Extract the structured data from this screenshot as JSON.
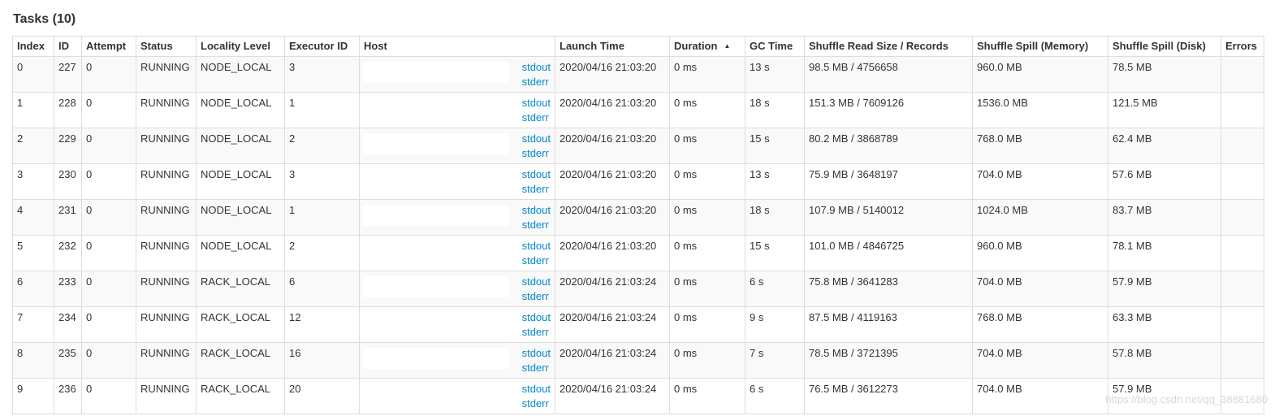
{
  "title": "Tasks (10)",
  "columns": [
    "Index",
    "ID",
    "Attempt",
    "Status",
    "Locality Level",
    "Executor ID",
    "Host",
    "Launch Time",
    "Duration",
    "GC Time",
    "Shuffle Read Size / Records",
    "Shuffle Spill (Memory)",
    "Shuffle Spill (Disk)",
    "Errors"
  ],
  "sort": {
    "column": "Duration",
    "direction": "ascending",
    "icon": "sort-up-icon"
  },
  "log_links": {
    "stdout": "stdout",
    "stderr": "stderr"
  },
  "rows": [
    {
      "index": "0",
      "id": "227",
      "attempt": "0",
      "status": "RUNNING",
      "locality": "NODE_LOCAL",
      "executor": "3",
      "launch": "2020/04/16 21:03:20",
      "duration": "0 ms",
      "gc": "13 s",
      "shuffle_read": "98.5 MB / 4756658",
      "spill_mem": "960.0 MB",
      "spill_disk": "78.5 MB",
      "errors": ""
    },
    {
      "index": "1",
      "id": "228",
      "attempt": "0",
      "status": "RUNNING",
      "locality": "NODE_LOCAL",
      "executor": "1",
      "launch": "2020/04/16 21:03:20",
      "duration": "0 ms",
      "gc": "18 s",
      "shuffle_read": "151.3 MB / 7609126",
      "spill_mem": "1536.0 MB",
      "spill_disk": "121.5 MB",
      "errors": ""
    },
    {
      "index": "2",
      "id": "229",
      "attempt": "0",
      "status": "RUNNING",
      "locality": "NODE_LOCAL",
      "executor": "2",
      "launch": "2020/04/16 21:03:20",
      "duration": "0 ms",
      "gc": "15 s",
      "shuffle_read": "80.2 MB / 3868789",
      "spill_mem": "768.0 MB",
      "spill_disk": "62.4 MB",
      "errors": ""
    },
    {
      "index": "3",
      "id": "230",
      "attempt": "0",
      "status": "RUNNING",
      "locality": "NODE_LOCAL",
      "executor": "3",
      "launch": "2020/04/16 21:03:20",
      "duration": "0 ms",
      "gc": "13 s",
      "shuffle_read": "75.9 MB / 3648197",
      "spill_mem": "704.0 MB",
      "spill_disk": "57.6 MB",
      "errors": ""
    },
    {
      "index": "4",
      "id": "231",
      "attempt": "0",
      "status": "RUNNING",
      "locality": "NODE_LOCAL",
      "executor": "1",
      "launch": "2020/04/16 21:03:20",
      "duration": "0 ms",
      "gc": "18 s",
      "shuffle_read": "107.9 MB / 5140012",
      "spill_mem": "1024.0 MB",
      "spill_disk": "83.7 MB",
      "errors": ""
    },
    {
      "index": "5",
      "id": "232",
      "attempt": "0",
      "status": "RUNNING",
      "locality": "NODE_LOCAL",
      "executor": "2",
      "launch": "2020/04/16 21:03:20",
      "duration": "0 ms",
      "gc": "15 s",
      "shuffle_read": "101.0 MB / 4846725",
      "spill_mem": "960.0 MB",
      "spill_disk": "78.1 MB",
      "errors": ""
    },
    {
      "index": "6",
      "id": "233",
      "attempt": "0",
      "status": "RUNNING",
      "locality": "RACK_LOCAL",
      "executor": "6",
      "launch": "2020/04/16 21:03:24",
      "duration": "0 ms",
      "gc": "6 s",
      "shuffle_read": "75.8 MB / 3641283",
      "spill_mem": "704.0 MB",
      "spill_disk": "57.9 MB",
      "errors": ""
    },
    {
      "index": "7",
      "id": "234",
      "attempt": "0",
      "status": "RUNNING",
      "locality": "RACK_LOCAL",
      "executor": "12",
      "launch": "2020/04/16 21:03:24",
      "duration": "0 ms",
      "gc": "9 s",
      "shuffle_read": "87.5 MB / 4119163",
      "spill_mem": "768.0 MB",
      "spill_disk": "63.3 MB",
      "errors": ""
    },
    {
      "index": "8",
      "id": "235",
      "attempt": "0",
      "status": "RUNNING",
      "locality": "RACK_LOCAL",
      "executor": "16",
      "launch": "2020/04/16 21:03:24",
      "duration": "0 ms",
      "gc": "7 s",
      "shuffle_read": "78.5 MB / 3721395",
      "spill_mem": "704.0 MB",
      "spill_disk": "57.8 MB",
      "errors": ""
    },
    {
      "index": "9",
      "id": "236",
      "attempt": "0",
      "status": "RUNNING",
      "locality": "RACK_LOCAL",
      "executor": "20",
      "launch": "2020/04/16 21:03:24",
      "duration": "0 ms",
      "gc": "6 s",
      "shuffle_read": "76.5 MB / 3612273",
      "spill_mem": "704.0 MB",
      "spill_disk": "57.9 MB",
      "errors": ""
    }
  ],
  "watermark": "https://blog.csdn.net/qq_38881680",
  "colors": {
    "link": "#0088cc",
    "border": "#dddddd",
    "stripe": "#f9f9f9"
  }
}
